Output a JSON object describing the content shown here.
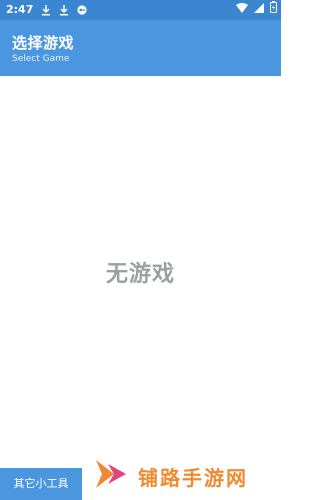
{
  "status_bar": {
    "time": "2:47",
    "icons": [
      "download-icon",
      "download-icon",
      "game-launcher-icon",
      "wifi-icon",
      "signal-icon",
      "battery-icon"
    ]
  },
  "app_bar": {
    "title": "选择游戏",
    "subtitle": "Select Game"
  },
  "main": {
    "empty_message": "无游戏"
  },
  "bottom": {
    "other_tools_label": "其它小工具"
  },
  "watermark": {
    "text": "铺路手游网"
  },
  "colors": {
    "status_bar": "#3a86d0",
    "app_bar": "#4a97df",
    "empty_text": "#9aa0a6",
    "watermark": "#f08a32"
  }
}
